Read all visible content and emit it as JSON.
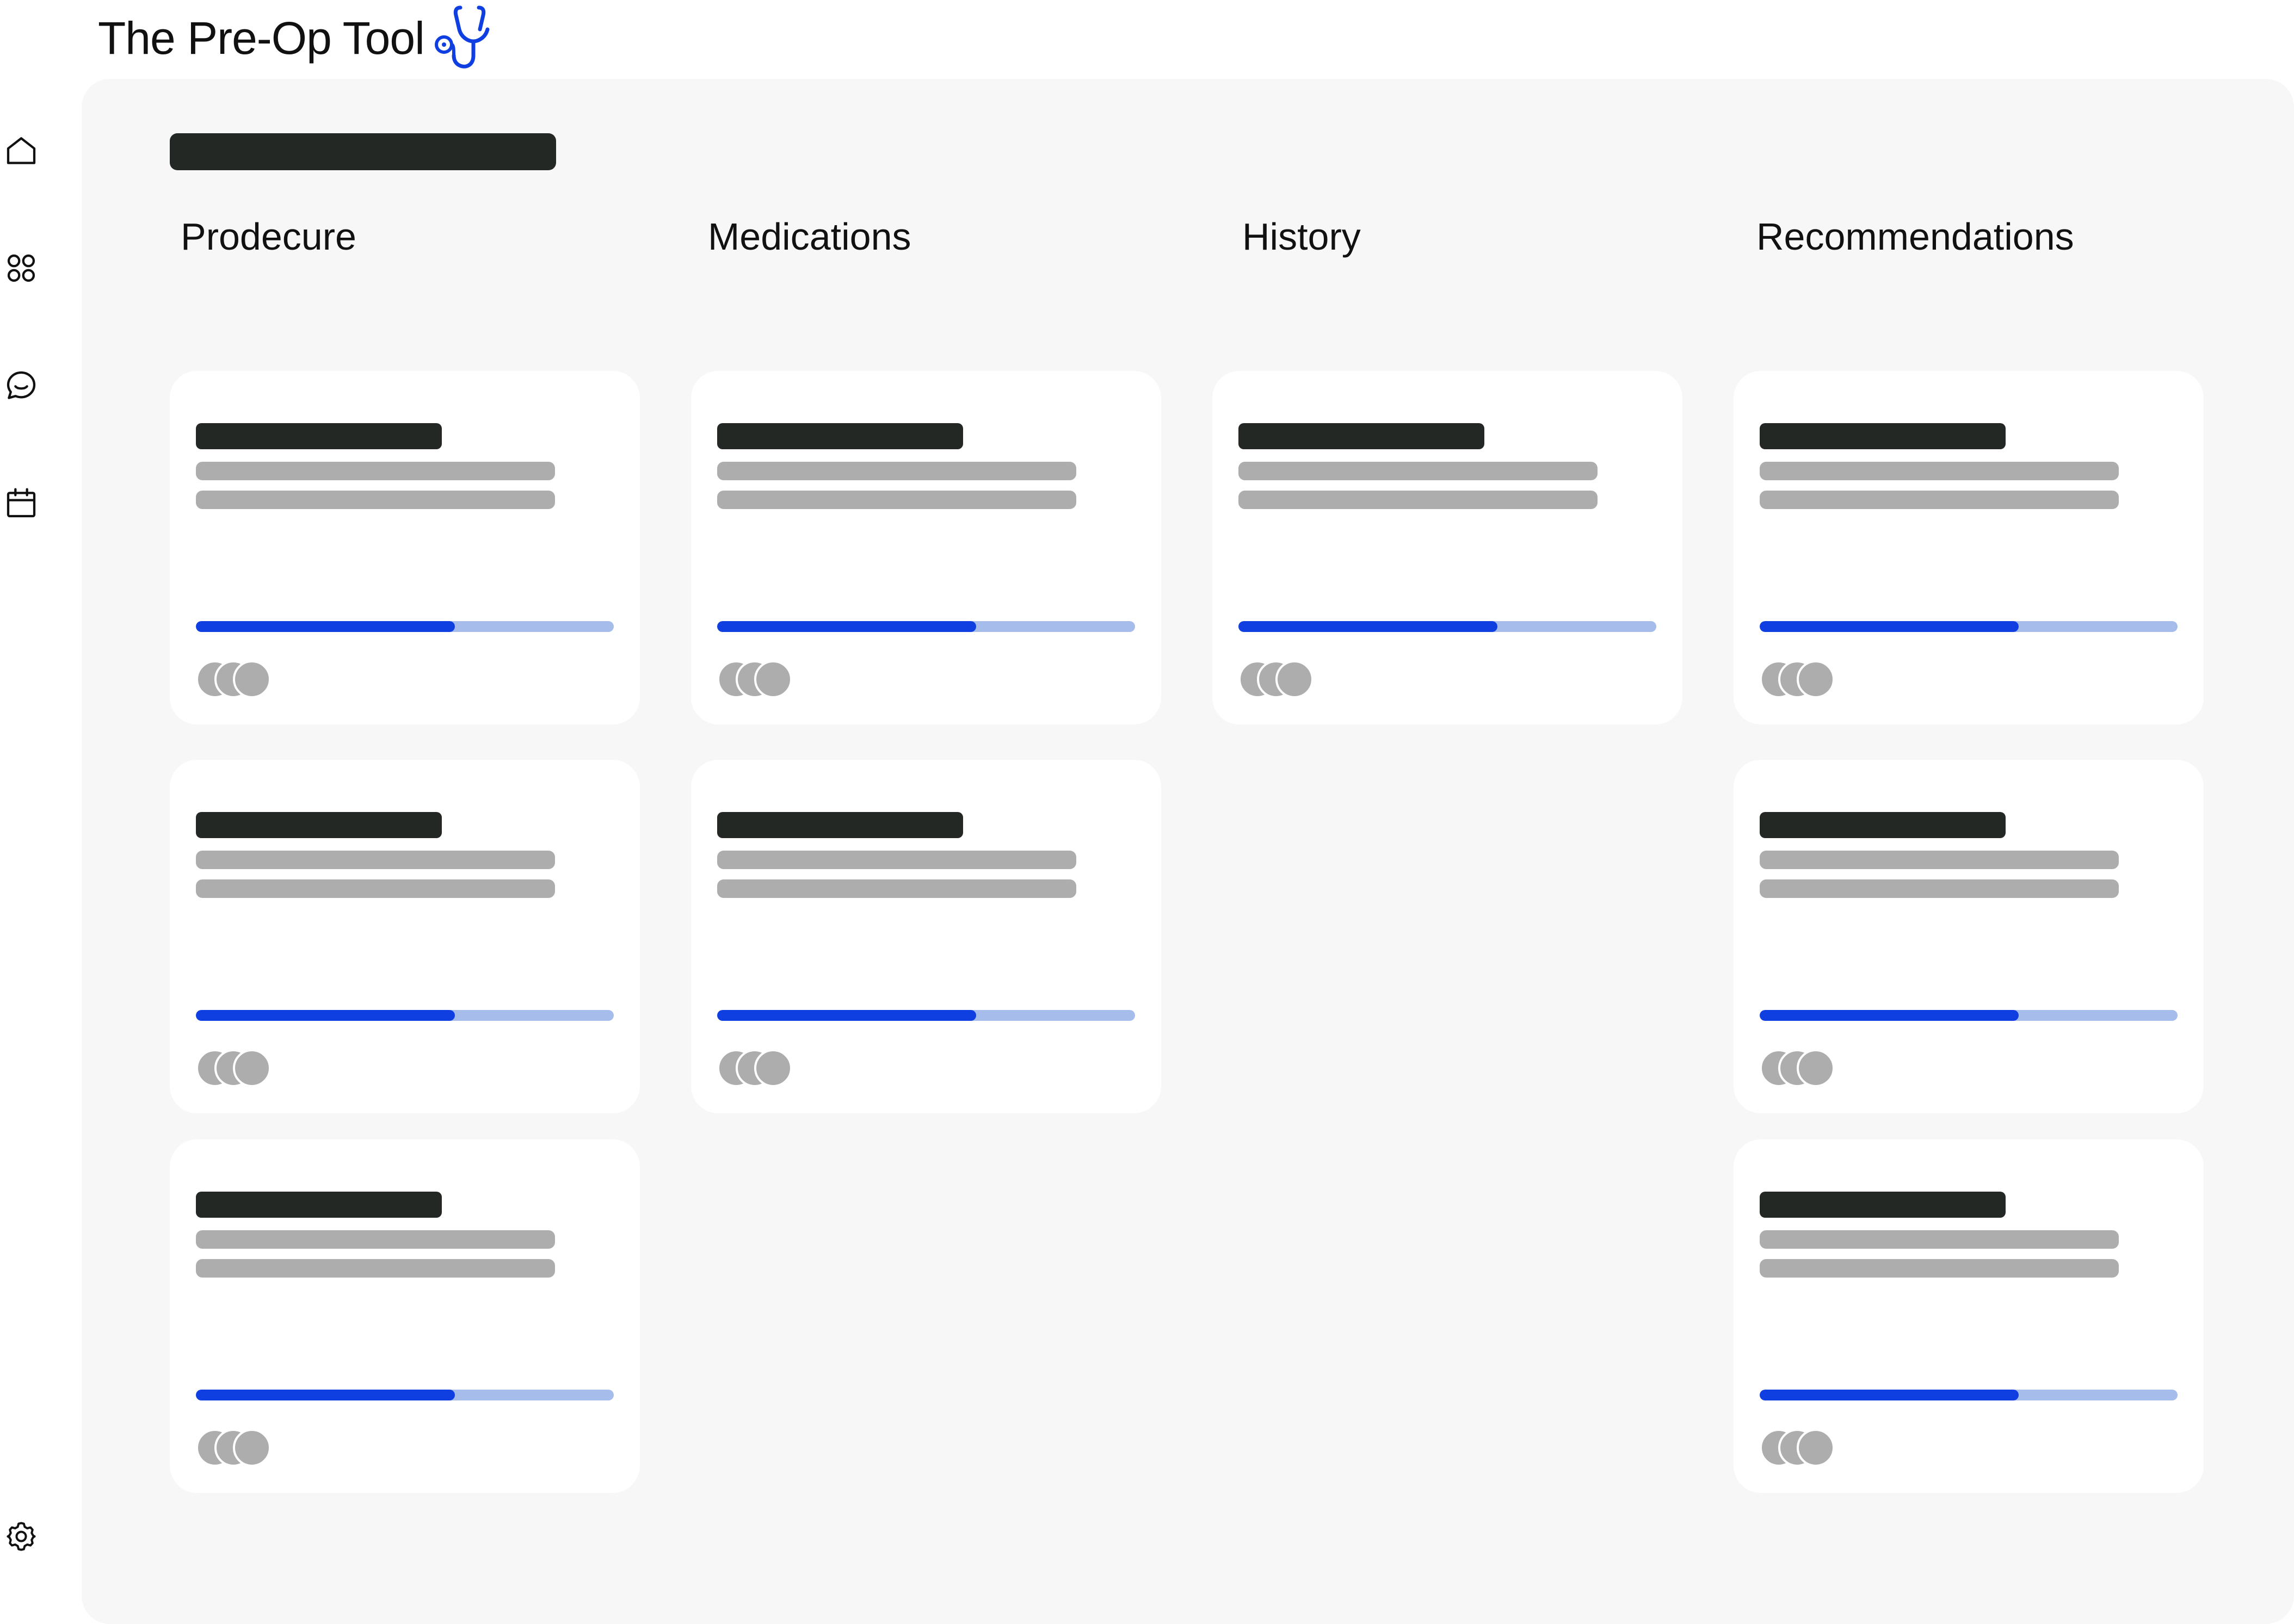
{
  "app": {
    "title": "The Pre-Op Tool",
    "logo_icon": "stethoscope-icon",
    "accent_color": "#0f3fe0",
    "accent_light_color": "#a6bcea"
  },
  "sidebar": {
    "items": [
      {
        "name": "home",
        "icon": "home-icon"
      },
      {
        "name": "apps",
        "icon": "grid-icon"
      },
      {
        "name": "messages",
        "icon": "chat-icon"
      },
      {
        "name": "calendar",
        "icon": "calendar-icon"
      },
      {
        "name": "settings",
        "icon": "gear-icon"
      }
    ]
  },
  "board": {
    "columns": [
      {
        "title": "Prodecure",
        "card_count": 3
      },
      {
        "title": "Medications",
        "card_count": 2
      },
      {
        "title": "History",
        "card_count": 1
      },
      {
        "title": "Recommendations",
        "card_count": 3
      }
    ],
    "card_progress_fraction": 0.62,
    "card_avatar_count": 3
  }
}
